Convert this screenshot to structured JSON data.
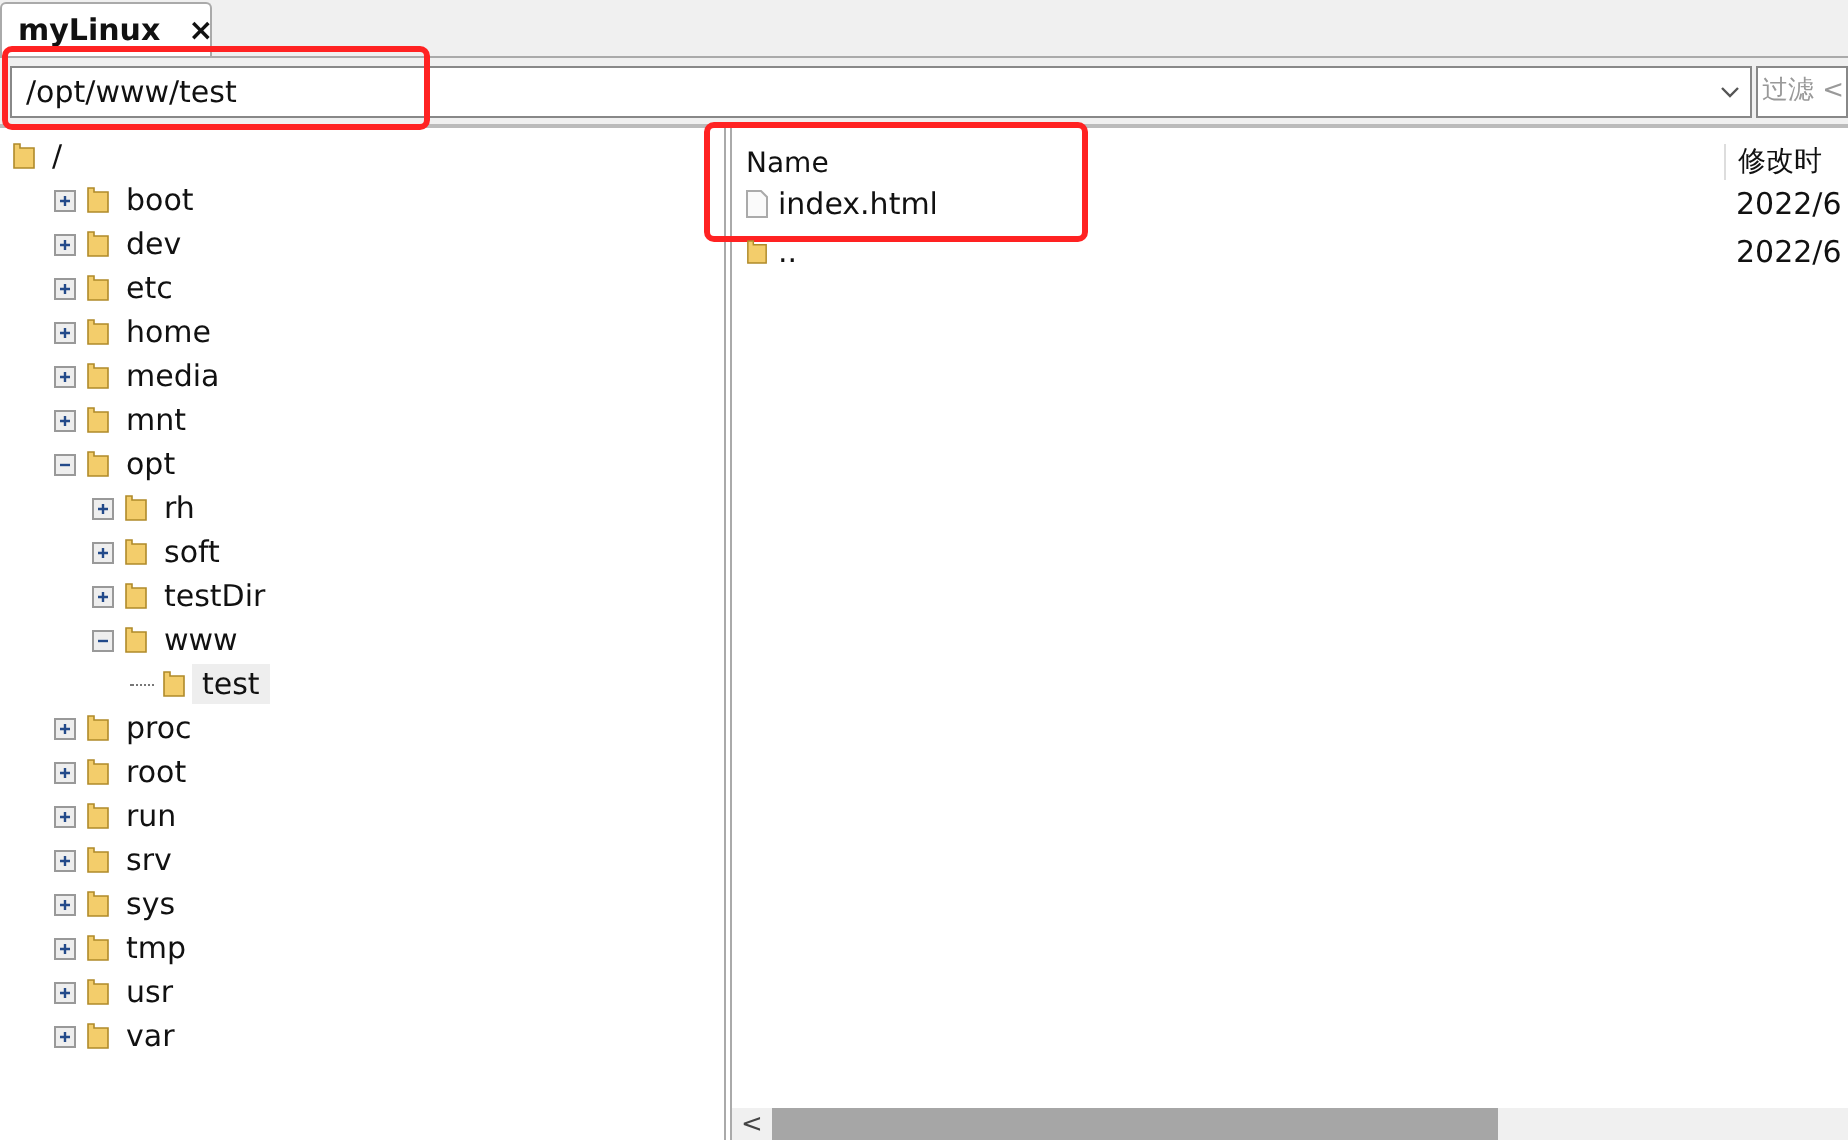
{
  "tab": {
    "title": "myLinux",
    "close": "×",
    "selected": true
  },
  "path_field": {
    "value": "/opt/www/test",
    "highlighted": true
  },
  "filter_field": {
    "placeholder": "过滤 <"
  },
  "tree": {
    "name": "/",
    "selected": false,
    "children": [
      {
        "name": "boot",
        "expandable": true,
        "expanded": false,
        "selected": false
      },
      {
        "name": "dev",
        "expandable": true,
        "expanded": false,
        "selected": false
      },
      {
        "name": "etc",
        "expandable": true,
        "expanded": false,
        "selected": false
      },
      {
        "name": "home",
        "expandable": true,
        "expanded": false,
        "selected": false
      },
      {
        "name": "media",
        "expandable": true,
        "expanded": false,
        "selected": false
      },
      {
        "name": "mnt",
        "expandable": true,
        "expanded": false,
        "selected": false
      },
      {
        "name": "opt",
        "expandable": true,
        "expanded": true,
        "selected": false,
        "children": [
          {
            "name": "rh",
            "expandable": true,
            "expanded": false,
            "selected": false
          },
          {
            "name": "soft",
            "expandable": true,
            "expanded": false,
            "selected": false
          },
          {
            "name": "testDir",
            "expandable": true,
            "expanded": false,
            "selected": false
          },
          {
            "name": "www",
            "expandable": true,
            "expanded": true,
            "selected": false,
            "children": [
              {
                "name": "test",
                "expandable": false,
                "expanded": false,
                "selected": true
              }
            ]
          }
        ]
      },
      {
        "name": "proc",
        "expandable": true,
        "expanded": false,
        "selected": false
      },
      {
        "name": "root",
        "expandable": true,
        "expanded": false,
        "selected": false
      },
      {
        "name": "run",
        "expandable": true,
        "expanded": false,
        "selected": false
      },
      {
        "name": "srv",
        "expandable": true,
        "expanded": false,
        "selected": false
      },
      {
        "name": "sys",
        "expandable": true,
        "expanded": false,
        "selected": false
      },
      {
        "name": "tmp",
        "expandable": true,
        "expanded": false,
        "selected": false
      },
      {
        "name": "usr",
        "expandable": true,
        "expanded": false,
        "selected": false
      },
      {
        "name": "var",
        "expandable": true,
        "expanded": false,
        "selected": false
      }
    ]
  },
  "file_list": {
    "columns": [
      "Name",
      "修改时"
    ],
    "rows": [
      {
        "kind": "file",
        "name": "index.html",
        "modified": "2022/6",
        "highlighted": true
      },
      {
        "kind": "folder",
        "name": "..",
        "modified": "2022/6",
        "highlighted": false
      }
    ]
  },
  "scrollbar": {
    "left_arrow": "<"
  }
}
